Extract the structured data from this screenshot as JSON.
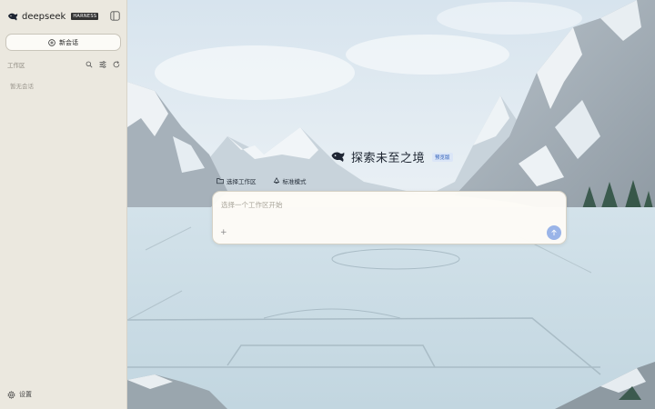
{
  "sidebar": {
    "brand_name": "deepseek",
    "brand_badge": "HARNESS",
    "new_chat_label": "新会话",
    "workspace_title": "工作区",
    "workspace_empty": "暂无会话",
    "settings_label": "设置"
  },
  "main": {
    "hero_title": "探索未至之境",
    "preview_badge": "预览版",
    "select_workspace_label": "选择工作区",
    "mode_label": "标准模式",
    "composer_placeholder": "选择一个工作区开始",
    "add_symbol": "+"
  },
  "icons": {
    "brand": "whale-logo-icon",
    "collapse": "sidebar-toggle-icon",
    "new_chat": "plus-circle-icon",
    "search": "search-icon",
    "filter": "filter-icon",
    "refresh": "refresh-icon",
    "settings": "gear-icon",
    "folder": "folder-icon",
    "mode": "recycle-icon",
    "send": "arrow-up-icon"
  },
  "colors": {
    "sidebar_bg": "#ebe8df",
    "accent": "#9ab4e8",
    "badge_bg": "#dbe6f7",
    "badge_text": "#2c5db8"
  }
}
